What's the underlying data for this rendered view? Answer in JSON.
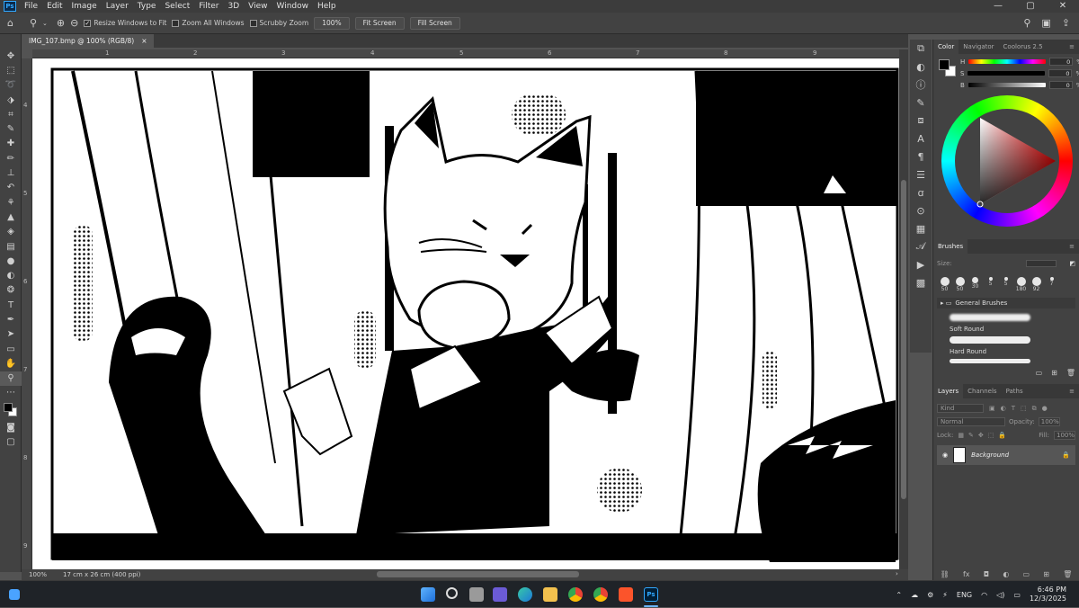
{
  "app": {
    "logo": "Ps"
  },
  "menu": [
    "File",
    "Edit",
    "Image",
    "Layer",
    "Type",
    "Select",
    "Filter",
    "3D",
    "View",
    "Window",
    "Help"
  ],
  "window_controls": [
    "—",
    "▢",
    "✕"
  ],
  "options": {
    "resize_windows": "Resize Windows to Fit",
    "zoom_all": "Zoom All Windows",
    "scrubby": "Scrubby Zoom",
    "zoom_value": "100%",
    "fit_screen": "Fit Screen",
    "fill_screen": "Fill Screen"
  },
  "document": {
    "tab_title": "IMG_107.bmp @ 100% (RGB/8)",
    "close": "×"
  },
  "ruler": {
    "h": [
      "1",
      "2",
      "3",
      "4",
      "5",
      "6",
      "7",
      "8",
      "9"
    ],
    "v": [
      "4",
      "5",
      "6",
      "7",
      "8",
      "9"
    ]
  },
  "status": {
    "zoom": "100%",
    "doc_info": "17 cm x 26 cm (400 ppi)"
  },
  "color_panel": {
    "tabs": [
      "Color",
      "Navigator",
      "Coolorus 2.5"
    ],
    "h_label": "H",
    "s_label": "S",
    "b_label": "B",
    "h": "0",
    "s": "0",
    "b": "0",
    "pct": "%",
    "fg": "#000000",
    "bg": "#ffffff"
  },
  "brushes_panel": {
    "title": "Brushes",
    "size_label": "Size:",
    "sizes": [
      "50",
      "50",
      "30",
      "5",
      "5",
      "180",
      "92",
      "7"
    ],
    "group": "General Brushes",
    "items": [
      "Soft Round",
      "Hard Round"
    ]
  },
  "layers_panel": {
    "tabs": [
      "Layers",
      "Channels",
      "Paths"
    ],
    "kind": "Kind",
    "blend": "Normal",
    "opacity_label": "Opacity:",
    "opacity": "100%",
    "lock_label": "Lock:",
    "fill_label": "Fill:",
    "fill": "100%",
    "layer_name": "Background"
  },
  "taskbar": {
    "lang": "ENG",
    "time": "6:46 PM",
    "date": "12/3/2025"
  }
}
